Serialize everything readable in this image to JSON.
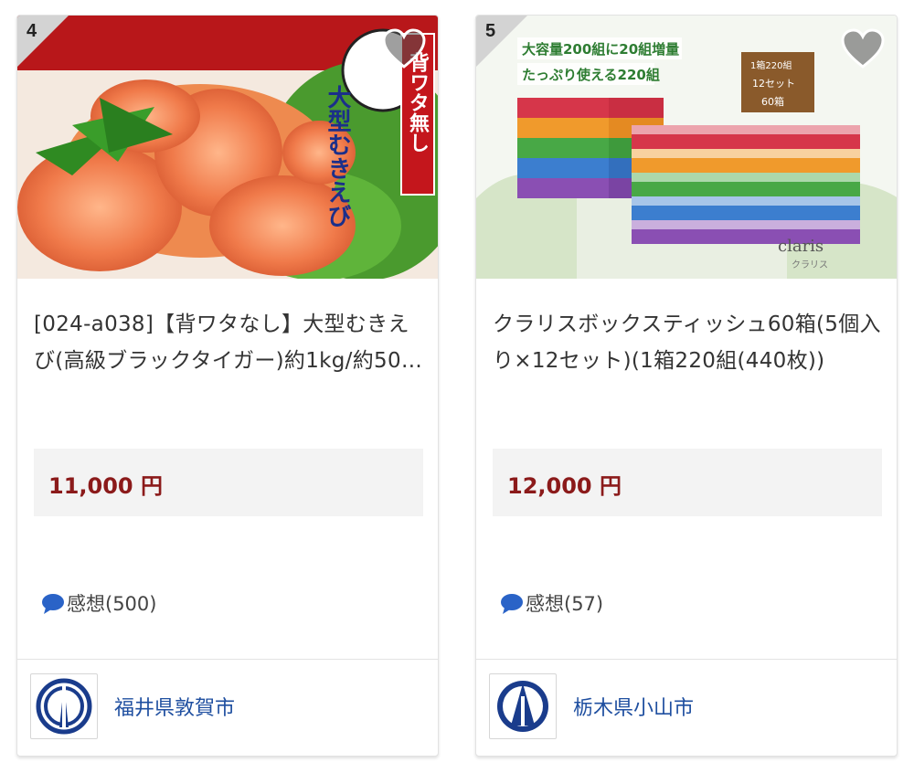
{
  "cards": [
    {
      "rank": "4",
      "image_text": {
        "main": "大型むきえび",
        "side": "背ワタ無し"
      },
      "title": "[024-a038]【背ワタなし】大型むきえび(高級ブラックタイガー)約1kg/約50…",
      "price": "11,000 円",
      "reviews": "感想(500)",
      "city": "福井県敦賀市",
      "icons": {
        "favorite": "heart-icon",
        "review": "speech-bubble-icon",
        "emblem": "city-emblem-icon"
      }
    },
    {
      "rank": "5",
      "image_text": {
        "line1": "大容量200組に20組増量",
        "line2": "たっぷり使える220組",
        "sign1": "1箱220組",
        "sign2": "12セット",
        "sign3": "60箱",
        "brand": "claris",
        "brand_kana": "クラリス"
      },
      "title": "クラリスボックスティッシュ60箱(5個入り×12セット)(1箱220組(440枚))",
      "price": "12,000 円",
      "reviews": "感想(57)",
      "city": "栃木県小山市",
      "icons": {
        "favorite": "heart-icon",
        "review": "speech-bubble-icon",
        "emblem": "city-emblem-icon"
      }
    }
  ],
  "colors": {
    "price": "#8b1a1a",
    "city_link": "#1f4fa0",
    "emblem": "#1a3c8c"
  }
}
